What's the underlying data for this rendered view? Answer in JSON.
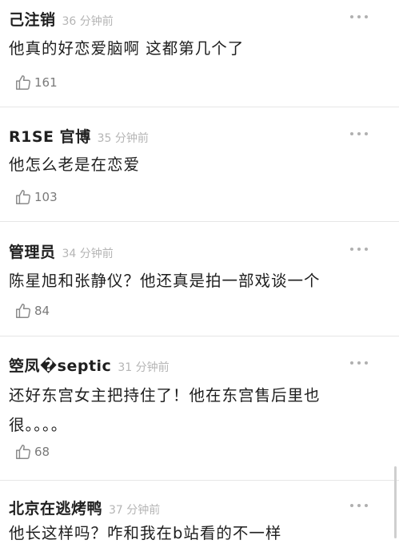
{
  "comments": [
    {
      "author": "己注销",
      "time": "36 分钟前",
      "text": "他真的好恋爱脑啊 这都第几个了",
      "likes": "161"
    },
    {
      "author": "R1SE 官博",
      "time": "35 分钟前",
      "text": "他怎么老是在恋爱",
      "likes": "103"
    },
    {
      "author": "管理员",
      "time": "34 分钟前",
      "text": "陈星旭和张静仪？他还真是拍一部戏谈一个",
      "likes": "84"
    },
    {
      "author": "箜凤�septic",
      "time": "31 分钟前",
      "text": "还好东宫女主把持住了！他在东宫售后里也\n很。。。。",
      "likes": "68"
    },
    {
      "author": "北京在逃烤鸭",
      "time": "37 分钟前",
      "text": "他长这样吗？咋和我在b站看的不一样",
      "likes": ""
    }
  ],
  "icons": {
    "like": "thumbs-up-icon",
    "more": "more-dots-icon"
  },
  "colors": {
    "text": "#1e1e1e",
    "muted": "#b5b5b5",
    "divider": "#e6e6e6",
    "count": "#7a7a7a"
  }
}
